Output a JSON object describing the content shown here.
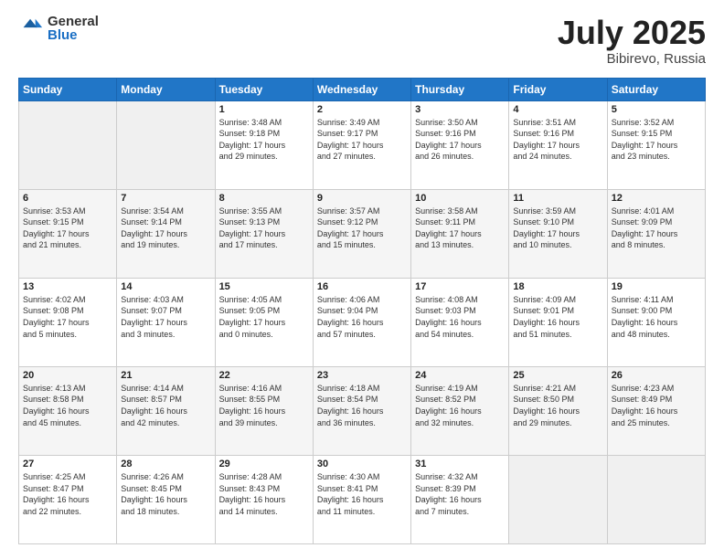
{
  "header": {
    "logo_general": "General",
    "logo_blue": "Blue",
    "title": "July 2025",
    "location": "Bibirevo, Russia"
  },
  "days_of_week": [
    "Sunday",
    "Monday",
    "Tuesday",
    "Wednesday",
    "Thursday",
    "Friday",
    "Saturday"
  ],
  "weeks": [
    [
      {
        "day": "",
        "info": ""
      },
      {
        "day": "",
        "info": ""
      },
      {
        "day": "1",
        "info": "Sunrise: 3:48 AM\nSunset: 9:18 PM\nDaylight: 17 hours\nand 29 minutes."
      },
      {
        "day": "2",
        "info": "Sunrise: 3:49 AM\nSunset: 9:17 PM\nDaylight: 17 hours\nand 27 minutes."
      },
      {
        "day": "3",
        "info": "Sunrise: 3:50 AM\nSunset: 9:16 PM\nDaylight: 17 hours\nand 26 minutes."
      },
      {
        "day": "4",
        "info": "Sunrise: 3:51 AM\nSunset: 9:16 PM\nDaylight: 17 hours\nand 24 minutes."
      },
      {
        "day": "5",
        "info": "Sunrise: 3:52 AM\nSunset: 9:15 PM\nDaylight: 17 hours\nand 23 minutes."
      }
    ],
    [
      {
        "day": "6",
        "info": "Sunrise: 3:53 AM\nSunset: 9:15 PM\nDaylight: 17 hours\nand 21 minutes."
      },
      {
        "day": "7",
        "info": "Sunrise: 3:54 AM\nSunset: 9:14 PM\nDaylight: 17 hours\nand 19 minutes."
      },
      {
        "day": "8",
        "info": "Sunrise: 3:55 AM\nSunset: 9:13 PM\nDaylight: 17 hours\nand 17 minutes."
      },
      {
        "day": "9",
        "info": "Sunrise: 3:57 AM\nSunset: 9:12 PM\nDaylight: 17 hours\nand 15 minutes."
      },
      {
        "day": "10",
        "info": "Sunrise: 3:58 AM\nSunset: 9:11 PM\nDaylight: 17 hours\nand 13 minutes."
      },
      {
        "day": "11",
        "info": "Sunrise: 3:59 AM\nSunset: 9:10 PM\nDaylight: 17 hours\nand 10 minutes."
      },
      {
        "day": "12",
        "info": "Sunrise: 4:01 AM\nSunset: 9:09 PM\nDaylight: 17 hours\nand 8 minutes."
      }
    ],
    [
      {
        "day": "13",
        "info": "Sunrise: 4:02 AM\nSunset: 9:08 PM\nDaylight: 17 hours\nand 5 minutes."
      },
      {
        "day": "14",
        "info": "Sunrise: 4:03 AM\nSunset: 9:07 PM\nDaylight: 17 hours\nand 3 minutes."
      },
      {
        "day": "15",
        "info": "Sunrise: 4:05 AM\nSunset: 9:05 PM\nDaylight: 17 hours\nand 0 minutes."
      },
      {
        "day": "16",
        "info": "Sunrise: 4:06 AM\nSunset: 9:04 PM\nDaylight: 16 hours\nand 57 minutes."
      },
      {
        "day": "17",
        "info": "Sunrise: 4:08 AM\nSunset: 9:03 PM\nDaylight: 16 hours\nand 54 minutes."
      },
      {
        "day": "18",
        "info": "Sunrise: 4:09 AM\nSunset: 9:01 PM\nDaylight: 16 hours\nand 51 minutes."
      },
      {
        "day": "19",
        "info": "Sunrise: 4:11 AM\nSunset: 9:00 PM\nDaylight: 16 hours\nand 48 minutes."
      }
    ],
    [
      {
        "day": "20",
        "info": "Sunrise: 4:13 AM\nSunset: 8:58 PM\nDaylight: 16 hours\nand 45 minutes."
      },
      {
        "day": "21",
        "info": "Sunrise: 4:14 AM\nSunset: 8:57 PM\nDaylight: 16 hours\nand 42 minutes."
      },
      {
        "day": "22",
        "info": "Sunrise: 4:16 AM\nSunset: 8:55 PM\nDaylight: 16 hours\nand 39 minutes."
      },
      {
        "day": "23",
        "info": "Sunrise: 4:18 AM\nSunset: 8:54 PM\nDaylight: 16 hours\nand 36 minutes."
      },
      {
        "day": "24",
        "info": "Sunrise: 4:19 AM\nSunset: 8:52 PM\nDaylight: 16 hours\nand 32 minutes."
      },
      {
        "day": "25",
        "info": "Sunrise: 4:21 AM\nSunset: 8:50 PM\nDaylight: 16 hours\nand 29 minutes."
      },
      {
        "day": "26",
        "info": "Sunrise: 4:23 AM\nSunset: 8:49 PM\nDaylight: 16 hours\nand 25 minutes."
      }
    ],
    [
      {
        "day": "27",
        "info": "Sunrise: 4:25 AM\nSunset: 8:47 PM\nDaylight: 16 hours\nand 22 minutes."
      },
      {
        "day": "28",
        "info": "Sunrise: 4:26 AM\nSunset: 8:45 PM\nDaylight: 16 hours\nand 18 minutes."
      },
      {
        "day": "29",
        "info": "Sunrise: 4:28 AM\nSunset: 8:43 PM\nDaylight: 16 hours\nand 14 minutes."
      },
      {
        "day": "30",
        "info": "Sunrise: 4:30 AM\nSunset: 8:41 PM\nDaylight: 16 hours\nand 11 minutes."
      },
      {
        "day": "31",
        "info": "Sunrise: 4:32 AM\nSunset: 8:39 PM\nDaylight: 16 hours\nand 7 minutes."
      },
      {
        "day": "",
        "info": ""
      },
      {
        "day": "",
        "info": ""
      }
    ]
  ]
}
